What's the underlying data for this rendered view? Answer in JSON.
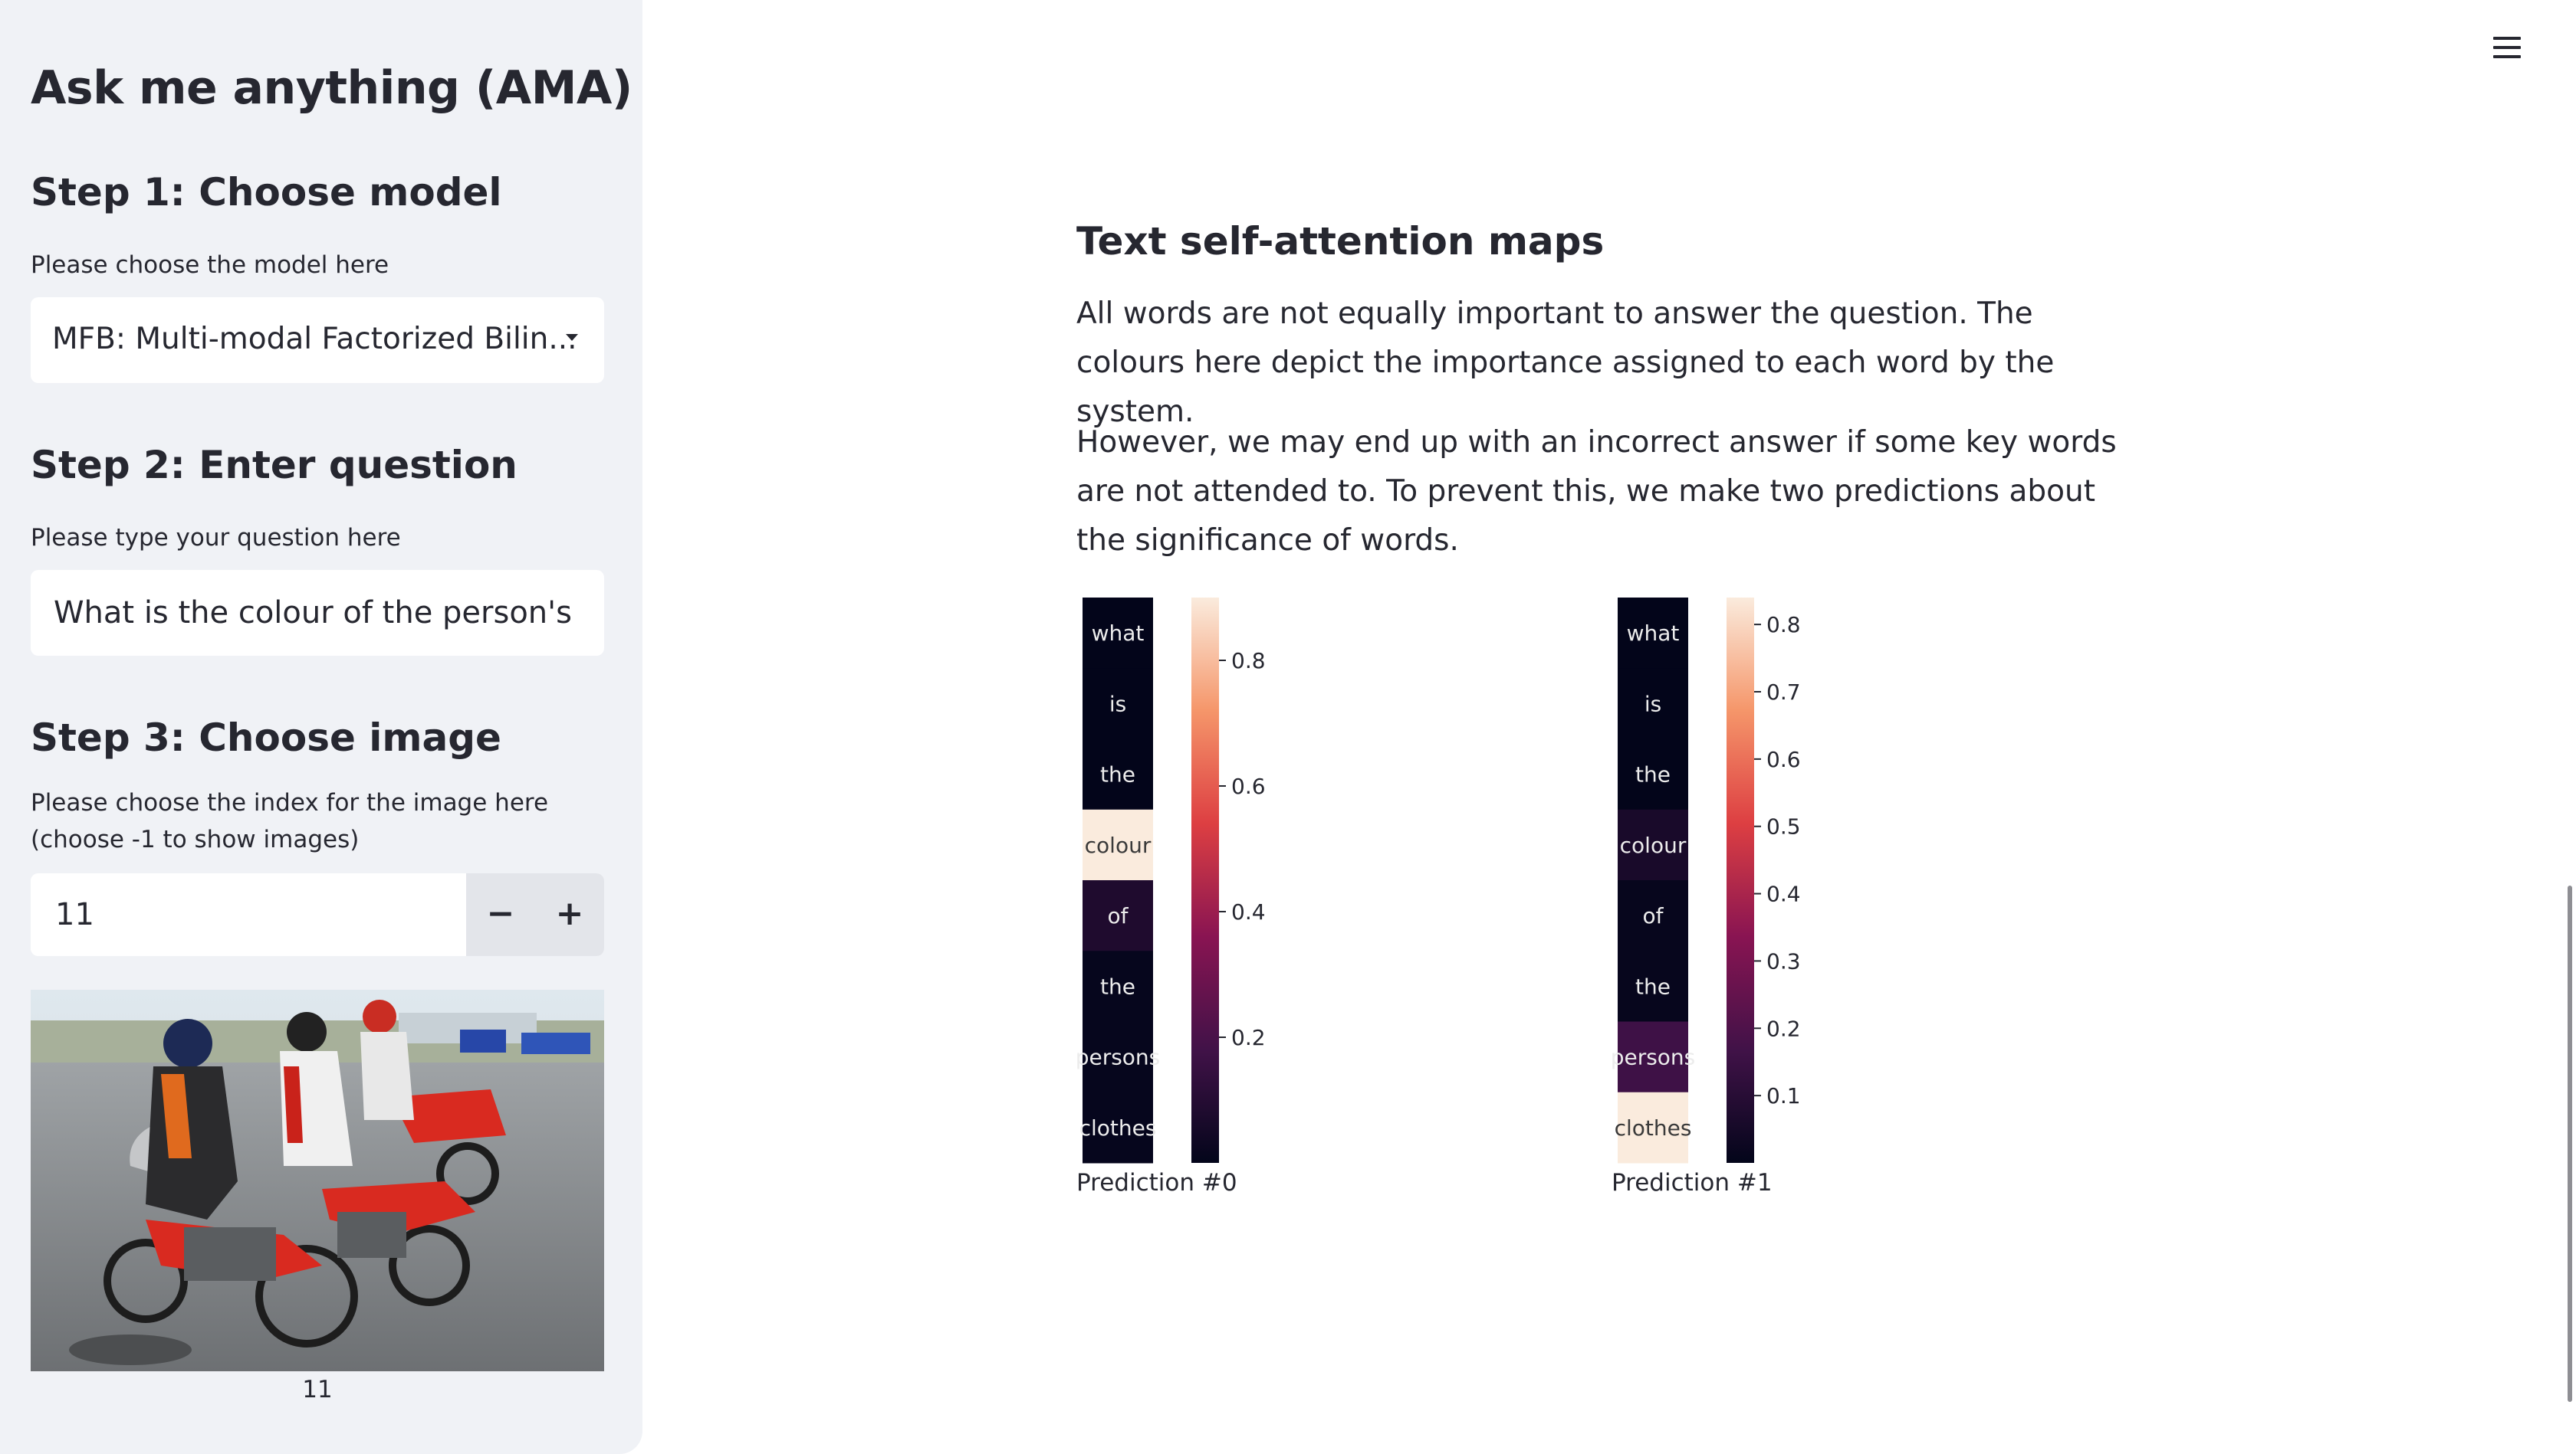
{
  "sidebar": {
    "title": "Ask me anything (AMA)",
    "step1": {
      "heading": "Step 1: Choose model",
      "hint": "Please choose the model here",
      "selected_model": "MFB: Multi-modal Factorized Bilin..."
    },
    "step2": {
      "heading": "Step 2: Enter question",
      "hint": "Please type your question here",
      "question_value": "What is the colour of the person's clothes"
    },
    "step3": {
      "heading": "Step 3: Choose image",
      "hint": "Please choose the index for the image here (choose -1 to show images)",
      "index_value": "11",
      "minus_label": "−",
      "plus_label": "+",
      "image_caption": "11"
    }
  },
  "main": {
    "menu_icon": "hamburger-menu-icon",
    "section_title": "Text self-attention maps",
    "paragraph1": "All words are not equally important to answer the question. The colours here depict the importance assigned to each word by the system.",
    "paragraph2": "However, we may end up with an incorrect answer if some key words are not attended to. To prevent this, we make two predictions about the significance of words."
  },
  "chart_data": [
    {
      "type": "heatmap",
      "title": "",
      "xlabel": "Prediction #0",
      "colormap": "rocket",
      "rows": [
        "what",
        "is",
        "the",
        "colour",
        "of",
        "the",
        "persons",
        "clothes"
      ],
      "values": [
        0.0,
        0.0,
        0.0,
        0.9,
        0.08,
        0.01,
        0.01,
        0.01
      ],
      "colorbar_ticks": [
        "0.2",
        "0.4",
        "0.6",
        "0.8"
      ],
      "colorbar_range": [
        0,
        0.9
      ]
    },
    {
      "type": "heatmap",
      "title": "",
      "xlabel": "Prediction #1",
      "colormap": "rocket",
      "rows": [
        "what",
        "is",
        "the",
        "colour",
        "of",
        "the",
        "persons",
        "clothes"
      ],
      "values": [
        0.0,
        0.0,
        0.0,
        0.06,
        0.01,
        0.01,
        0.16,
        0.84
      ],
      "colorbar_ticks": [
        "0.1",
        "0.2",
        "0.3",
        "0.4",
        "0.5",
        "0.6",
        "0.7",
        "0.8"
      ],
      "colorbar_range": [
        0,
        0.84
      ]
    }
  ]
}
